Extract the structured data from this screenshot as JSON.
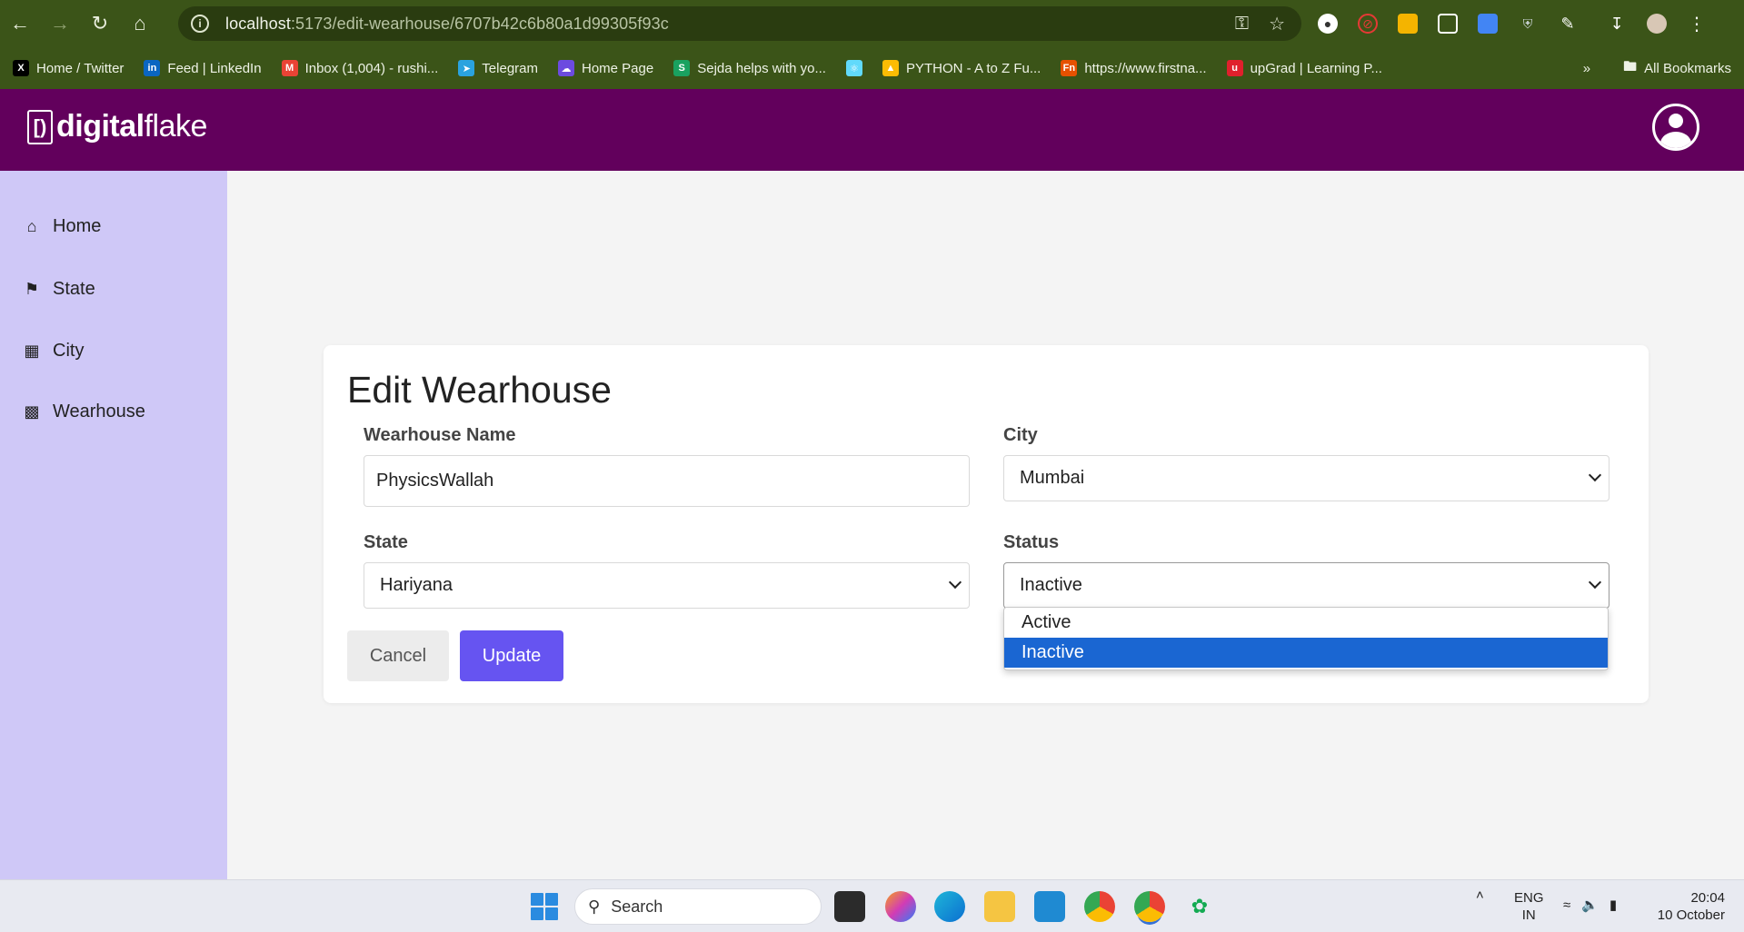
{
  "browser": {
    "url_host": "localhost",
    "url_rest": ":5173/edit-wearhouse/6707b42c6b80a1d99305f93c",
    "bookmarks": [
      {
        "label": "Home / Twitter",
        "icon": "x-logo-icon",
        "color": "#000000"
      },
      {
        "label": "Feed | LinkedIn",
        "icon": "linkedin-icon",
        "color": "#0a66c2"
      },
      {
        "label": "Inbox (1,004) - rushi...",
        "icon": "gmail-icon",
        "color": "#ea4335"
      },
      {
        "label": "Telegram",
        "icon": "telegram-icon",
        "color": "#2aa3df"
      },
      {
        "label": "Home Page",
        "icon": "cloud-icon",
        "color": "#6c4be0"
      },
      {
        "label": "Sejda helps with yo...",
        "icon": "sejda-icon",
        "color": "#1aa260"
      },
      {
        "label": "",
        "icon": "react-icon",
        "color": "#61dafb"
      },
      {
        "label": "PYTHON - A to Z Fu...",
        "icon": "drive-icon",
        "color": "#fbbc04"
      },
      {
        "label": "https://www.firstna...",
        "icon": "fn-icon",
        "color": "#e65100"
      },
      {
        "label": "upGrad | Learning P...",
        "icon": "upgrad-icon",
        "color": "#e0202c"
      }
    ],
    "all_bookmarks": "All Bookmarks",
    "more": "»"
  },
  "header": {
    "logo_mark": "[)",
    "logo_bold": "digital",
    "logo_light": "flake"
  },
  "sidebar": {
    "items": [
      {
        "label": "Home",
        "icon": "home-icon"
      },
      {
        "label": "State",
        "icon": "map-icon"
      },
      {
        "label": "City",
        "icon": "city-icon"
      },
      {
        "label": "Wearhouse",
        "icon": "warehouse-icon"
      }
    ]
  },
  "form": {
    "title": "Edit Wearhouse",
    "name_label": "Wearhouse Name",
    "name_value": "PhysicsWallah",
    "city_label": "City",
    "city_value": "Mumbai",
    "state_label": "State",
    "state_value": "Hariyana",
    "status_label": "Status",
    "status_value": "Inactive",
    "status_options": [
      "Active",
      "Inactive"
    ],
    "cancel_label": "Cancel",
    "update_label": "Update"
  },
  "taskbar": {
    "search_label": "Search",
    "lang_line1": "ENG",
    "lang_line2": "IN",
    "time": "20:04",
    "date": "10 October"
  },
  "colors": {
    "browser_chrome": "#3b5418",
    "app_header": "#62005c",
    "sidebar": "#cfc8f7",
    "primary_button": "#6654f1",
    "dropdown_selected": "#1a66d2"
  }
}
